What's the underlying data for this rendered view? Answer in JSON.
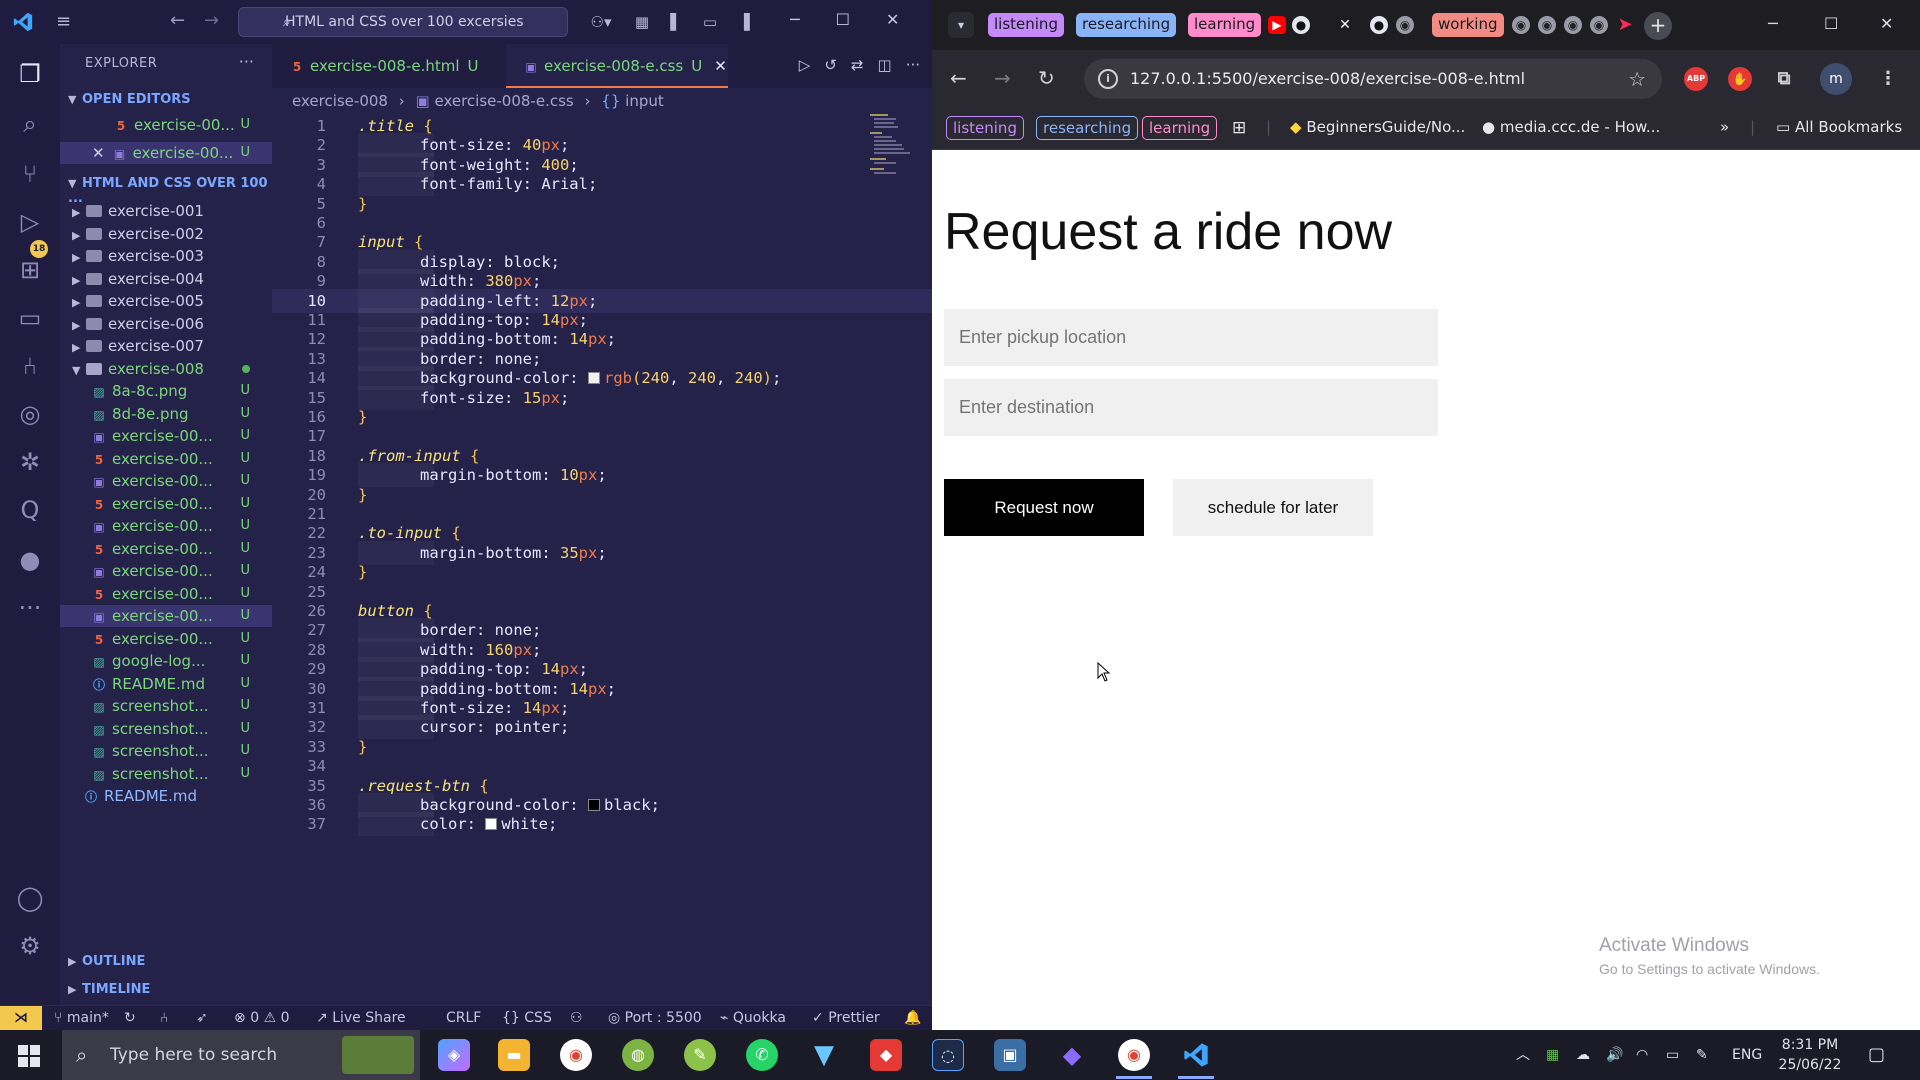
{
  "vscode": {
    "command_center": "HTML and CSS over 100 excersies",
    "explorer_title": "EXPLORER",
    "open_editors_label": "OPEN EDITORS",
    "open_editors": [
      {
        "name": "exercise-00...",
        "status": "U",
        "type": "html",
        "closable": false
      },
      {
        "name": "exercise-00...",
        "status": "U",
        "type": "css",
        "closable": true
      }
    ],
    "workspace_label": "HTML AND CSS OVER 100 ...",
    "folders": [
      "exercise-001",
      "exercise-002",
      "exercise-003",
      "exercise-004",
      "exercise-005",
      "exercise-006",
      "exercise-007"
    ],
    "open_folder": "exercise-008",
    "files": [
      {
        "name": "8a-8c.png",
        "type": "png",
        "status": "U"
      },
      {
        "name": "8d-8e.png",
        "type": "png",
        "status": "U"
      },
      {
        "name": "exercise-00...",
        "type": "css",
        "status": "U"
      },
      {
        "name": "exercise-00...",
        "type": "html",
        "status": "U"
      },
      {
        "name": "exercise-00...",
        "type": "css",
        "status": "U"
      },
      {
        "name": "exercise-00...",
        "type": "html",
        "status": "U"
      },
      {
        "name": "exercise-00...",
        "type": "css",
        "status": "U"
      },
      {
        "name": "exercise-00...",
        "type": "html",
        "status": "U"
      },
      {
        "name": "exercise-00...",
        "type": "css",
        "status": "U"
      },
      {
        "name": "exercise-00...",
        "type": "html",
        "status": "U"
      },
      {
        "name": "exercise-00...",
        "type": "css",
        "status": "U"
      },
      {
        "name": "exercise-00...",
        "type": "html",
        "status": "U"
      },
      {
        "name": "google-log...",
        "type": "png",
        "status": "U"
      },
      {
        "name": "README.md",
        "type": "info",
        "status": "U"
      },
      {
        "name": "screenshot...",
        "type": "png",
        "status": "U"
      },
      {
        "name": "screenshot...",
        "type": "png",
        "status": "U"
      },
      {
        "name": "screenshot...",
        "type": "png",
        "status": "U"
      },
      {
        "name": "screenshot...",
        "type": "png",
        "status": "U"
      }
    ],
    "root_readme": "README.md",
    "outline_label": "OUTLINE",
    "timeline_label": "TIMELINE",
    "tabs": [
      {
        "label": "exercise-008-e.html",
        "mod": "U"
      },
      {
        "label": "exercise-008-e.css",
        "mod": "U"
      }
    ],
    "breadcrumb": [
      "exercise-008",
      "exercise-008-e.css",
      "input"
    ],
    "current_line": 10,
    "code": [
      {
        "n": "1",
        "t": [
          [
            "sel",
            ".title"
          ],
          [
            "plain",
            " "
          ],
          [
            "brace",
            "{"
          ]
        ]
      },
      {
        "n": "2",
        "t": [
          [
            "ind",
            ""
          ],
          [
            "prop",
            "font-size: "
          ],
          [
            "val",
            "40"
          ],
          [
            "unit",
            "px"
          ],
          [
            "prop",
            ";"
          ]
        ]
      },
      {
        "n": "3",
        "t": [
          [
            "ind",
            ""
          ],
          [
            "prop",
            "font-weight: "
          ],
          [
            "val",
            "400"
          ],
          [
            "prop",
            ";"
          ]
        ]
      },
      {
        "n": "4",
        "t": [
          [
            "ind",
            ""
          ],
          [
            "prop",
            "font-family: Arial;"
          ]
        ]
      },
      {
        "n": "5",
        "t": [
          [
            "brace",
            "}"
          ]
        ]
      },
      {
        "n": "6",
        "t": []
      },
      {
        "n": "7",
        "t": [
          [
            "sel",
            "input"
          ],
          [
            "plain",
            " "
          ],
          [
            "brace",
            "{"
          ]
        ]
      },
      {
        "n": "8",
        "t": [
          [
            "ind",
            ""
          ],
          [
            "prop",
            "display: block;"
          ]
        ]
      },
      {
        "n": "9",
        "t": [
          [
            "ind",
            ""
          ],
          [
            "prop",
            "width: "
          ],
          [
            "val",
            "380"
          ],
          [
            "unit",
            "px"
          ],
          [
            "prop",
            ";"
          ]
        ]
      },
      {
        "n": "10",
        "t": [
          [
            "ind",
            ""
          ],
          [
            "prop",
            "padding-left: "
          ],
          [
            "val",
            "12"
          ],
          [
            "unit",
            "px"
          ],
          [
            "prop",
            ";"
          ]
        ]
      },
      {
        "n": "11",
        "t": [
          [
            "ind",
            ""
          ],
          [
            "prop",
            "padding-top: "
          ],
          [
            "val",
            "14"
          ],
          [
            "unit",
            "px"
          ],
          [
            "prop",
            ";"
          ]
        ]
      },
      {
        "n": "12",
        "t": [
          [
            "ind",
            ""
          ],
          [
            "prop",
            "padding-bottom: "
          ],
          [
            "val",
            "14"
          ],
          [
            "unit",
            "px"
          ],
          [
            "prop",
            ";"
          ]
        ]
      },
      {
        "n": "13",
        "t": [
          [
            "ind",
            ""
          ],
          [
            "prop",
            "border: none;"
          ]
        ]
      },
      {
        "n": "14",
        "t": [
          [
            "ind",
            ""
          ],
          [
            "prop",
            "background-color: "
          ],
          [
            "sw",
            "#f0f0f0"
          ],
          [
            "unit",
            "rgb"
          ],
          [
            "brace",
            "("
          ],
          [
            "val",
            "240"
          ],
          [
            "prop",
            ", "
          ],
          [
            "val",
            "240"
          ],
          [
            "prop",
            ", "
          ],
          [
            "val",
            "240"
          ],
          [
            "brace",
            ")"
          ],
          [
            "prop",
            ";"
          ]
        ]
      },
      {
        "n": "15",
        "t": [
          [
            "ind",
            ""
          ],
          [
            "prop",
            "font-size: "
          ],
          [
            "val",
            "15"
          ],
          [
            "unit",
            "px"
          ],
          [
            "prop",
            ";"
          ]
        ]
      },
      {
        "n": "16",
        "t": [
          [
            "brace",
            "}"
          ]
        ]
      },
      {
        "n": "17",
        "t": []
      },
      {
        "n": "18",
        "t": [
          [
            "sel",
            ".from-input"
          ],
          [
            "plain",
            " "
          ],
          [
            "brace",
            "{"
          ]
        ]
      },
      {
        "n": "19",
        "t": [
          [
            "ind",
            ""
          ],
          [
            "prop",
            "margin-bottom: "
          ],
          [
            "val",
            "10"
          ],
          [
            "unit",
            "px"
          ],
          [
            "prop",
            ";"
          ]
        ]
      },
      {
        "n": "20",
        "t": [
          [
            "brace",
            "}"
          ]
        ]
      },
      {
        "n": "21",
        "t": []
      },
      {
        "n": "22",
        "t": [
          [
            "sel",
            ".to-input"
          ],
          [
            "plain",
            " "
          ],
          [
            "brace",
            "{"
          ]
        ]
      },
      {
        "n": "23",
        "t": [
          [
            "ind",
            ""
          ],
          [
            "prop",
            "margin-bottom: "
          ],
          [
            "val",
            "35"
          ],
          [
            "unit",
            "px"
          ],
          [
            "prop",
            ";"
          ]
        ]
      },
      {
        "n": "24",
        "t": [
          [
            "brace",
            "}"
          ]
        ]
      },
      {
        "n": "25",
        "t": []
      },
      {
        "n": "26",
        "t": [
          [
            "sel",
            "button"
          ],
          [
            "plain",
            " "
          ],
          [
            "brace",
            "{"
          ]
        ]
      },
      {
        "n": "27",
        "t": [
          [
            "ind",
            ""
          ],
          [
            "prop",
            "border: none;"
          ]
        ]
      },
      {
        "n": "28",
        "t": [
          [
            "ind",
            ""
          ],
          [
            "prop",
            "width: "
          ],
          [
            "val",
            "160"
          ],
          [
            "unit",
            "px"
          ],
          [
            "prop",
            ";"
          ]
        ]
      },
      {
        "n": "29",
        "t": [
          [
            "ind",
            ""
          ],
          [
            "prop",
            "padding-top: "
          ],
          [
            "val",
            "14"
          ],
          [
            "unit",
            "px"
          ],
          [
            "prop",
            ";"
          ]
        ]
      },
      {
        "n": "30",
        "t": [
          [
            "ind",
            ""
          ],
          [
            "prop",
            "padding-bottom: "
          ],
          [
            "val",
            "14"
          ],
          [
            "unit",
            "px"
          ],
          [
            "prop",
            ";"
          ]
        ]
      },
      {
        "n": "31",
        "t": [
          [
            "ind",
            ""
          ],
          [
            "prop",
            "font-size: "
          ],
          [
            "val",
            "14"
          ],
          [
            "unit",
            "px"
          ],
          [
            "prop",
            ";"
          ]
        ]
      },
      {
        "n": "32",
        "t": [
          [
            "ind",
            ""
          ],
          [
            "prop",
            "cursor: pointer;"
          ]
        ]
      },
      {
        "n": "33",
        "t": [
          [
            "brace",
            "}"
          ]
        ]
      },
      {
        "n": "34",
        "t": []
      },
      {
        "n": "35",
        "t": [
          [
            "sel",
            ".request-btn"
          ],
          [
            "plain",
            " "
          ],
          [
            "brace",
            "{"
          ]
        ]
      },
      {
        "n": "36",
        "t": [
          [
            "ind",
            ""
          ],
          [
            "prop",
            "background-color: "
          ],
          [
            "sw",
            "#000000"
          ],
          [
            "prop",
            "black;"
          ]
        ]
      },
      {
        "n": "37",
        "t": [
          [
            "ind",
            ""
          ],
          [
            "prop",
            "color: "
          ],
          [
            "sw",
            "#ffffff"
          ],
          [
            "prop",
            "white;"
          ]
        ]
      }
    ],
    "status": {
      "branch": "main*",
      "problems": "0",
      "warnings": "0",
      "live_share": "Live Share",
      "eol": "CRLF",
      "language": "CSS",
      "port": "Port : 5500",
      "quokka": "Quokka",
      "prettier": "Prettier"
    },
    "scm_badge": "18"
  },
  "chrome": {
    "tab_groups": [
      {
        "label": "listening",
        "color": "#c58af9"
      },
      {
        "label": "researching",
        "color": "#8ab4f8"
      },
      {
        "label": "learning",
        "color": "#ff8bcb"
      },
      {
        "label": "working",
        "color": "#f28b82"
      }
    ],
    "url": "127.0.0.1:5500/exercise-008/exercise-008-e.html",
    "profile_initial": "m",
    "bookmark_groups": [
      {
        "label": "listening",
        "color": "#c58af9"
      },
      {
        "label": "researching",
        "color": "#8ab4f8"
      },
      {
        "label": "learning",
        "color": "#ff8bcb"
      }
    ],
    "bookmarks": [
      "BeginnersGuide/No...",
      "media.ccc.de - How..."
    ],
    "all_bookmarks": "All Bookmarks",
    "ext_abp": "ABP"
  },
  "page": {
    "title": "Request a ride now",
    "pickup_placeholder": "Enter pickup location",
    "destination_placeholder": "Enter destination",
    "request_btn": "Request now",
    "schedule_btn": "schedule for later",
    "activate_title": "Activate Windows",
    "activate_sub": "Go to Settings to activate Windows."
  },
  "taskbar": {
    "search_placeholder": "Type here to search",
    "language": "ENG",
    "time": "8:31 PM",
    "date": "25/06/22"
  }
}
